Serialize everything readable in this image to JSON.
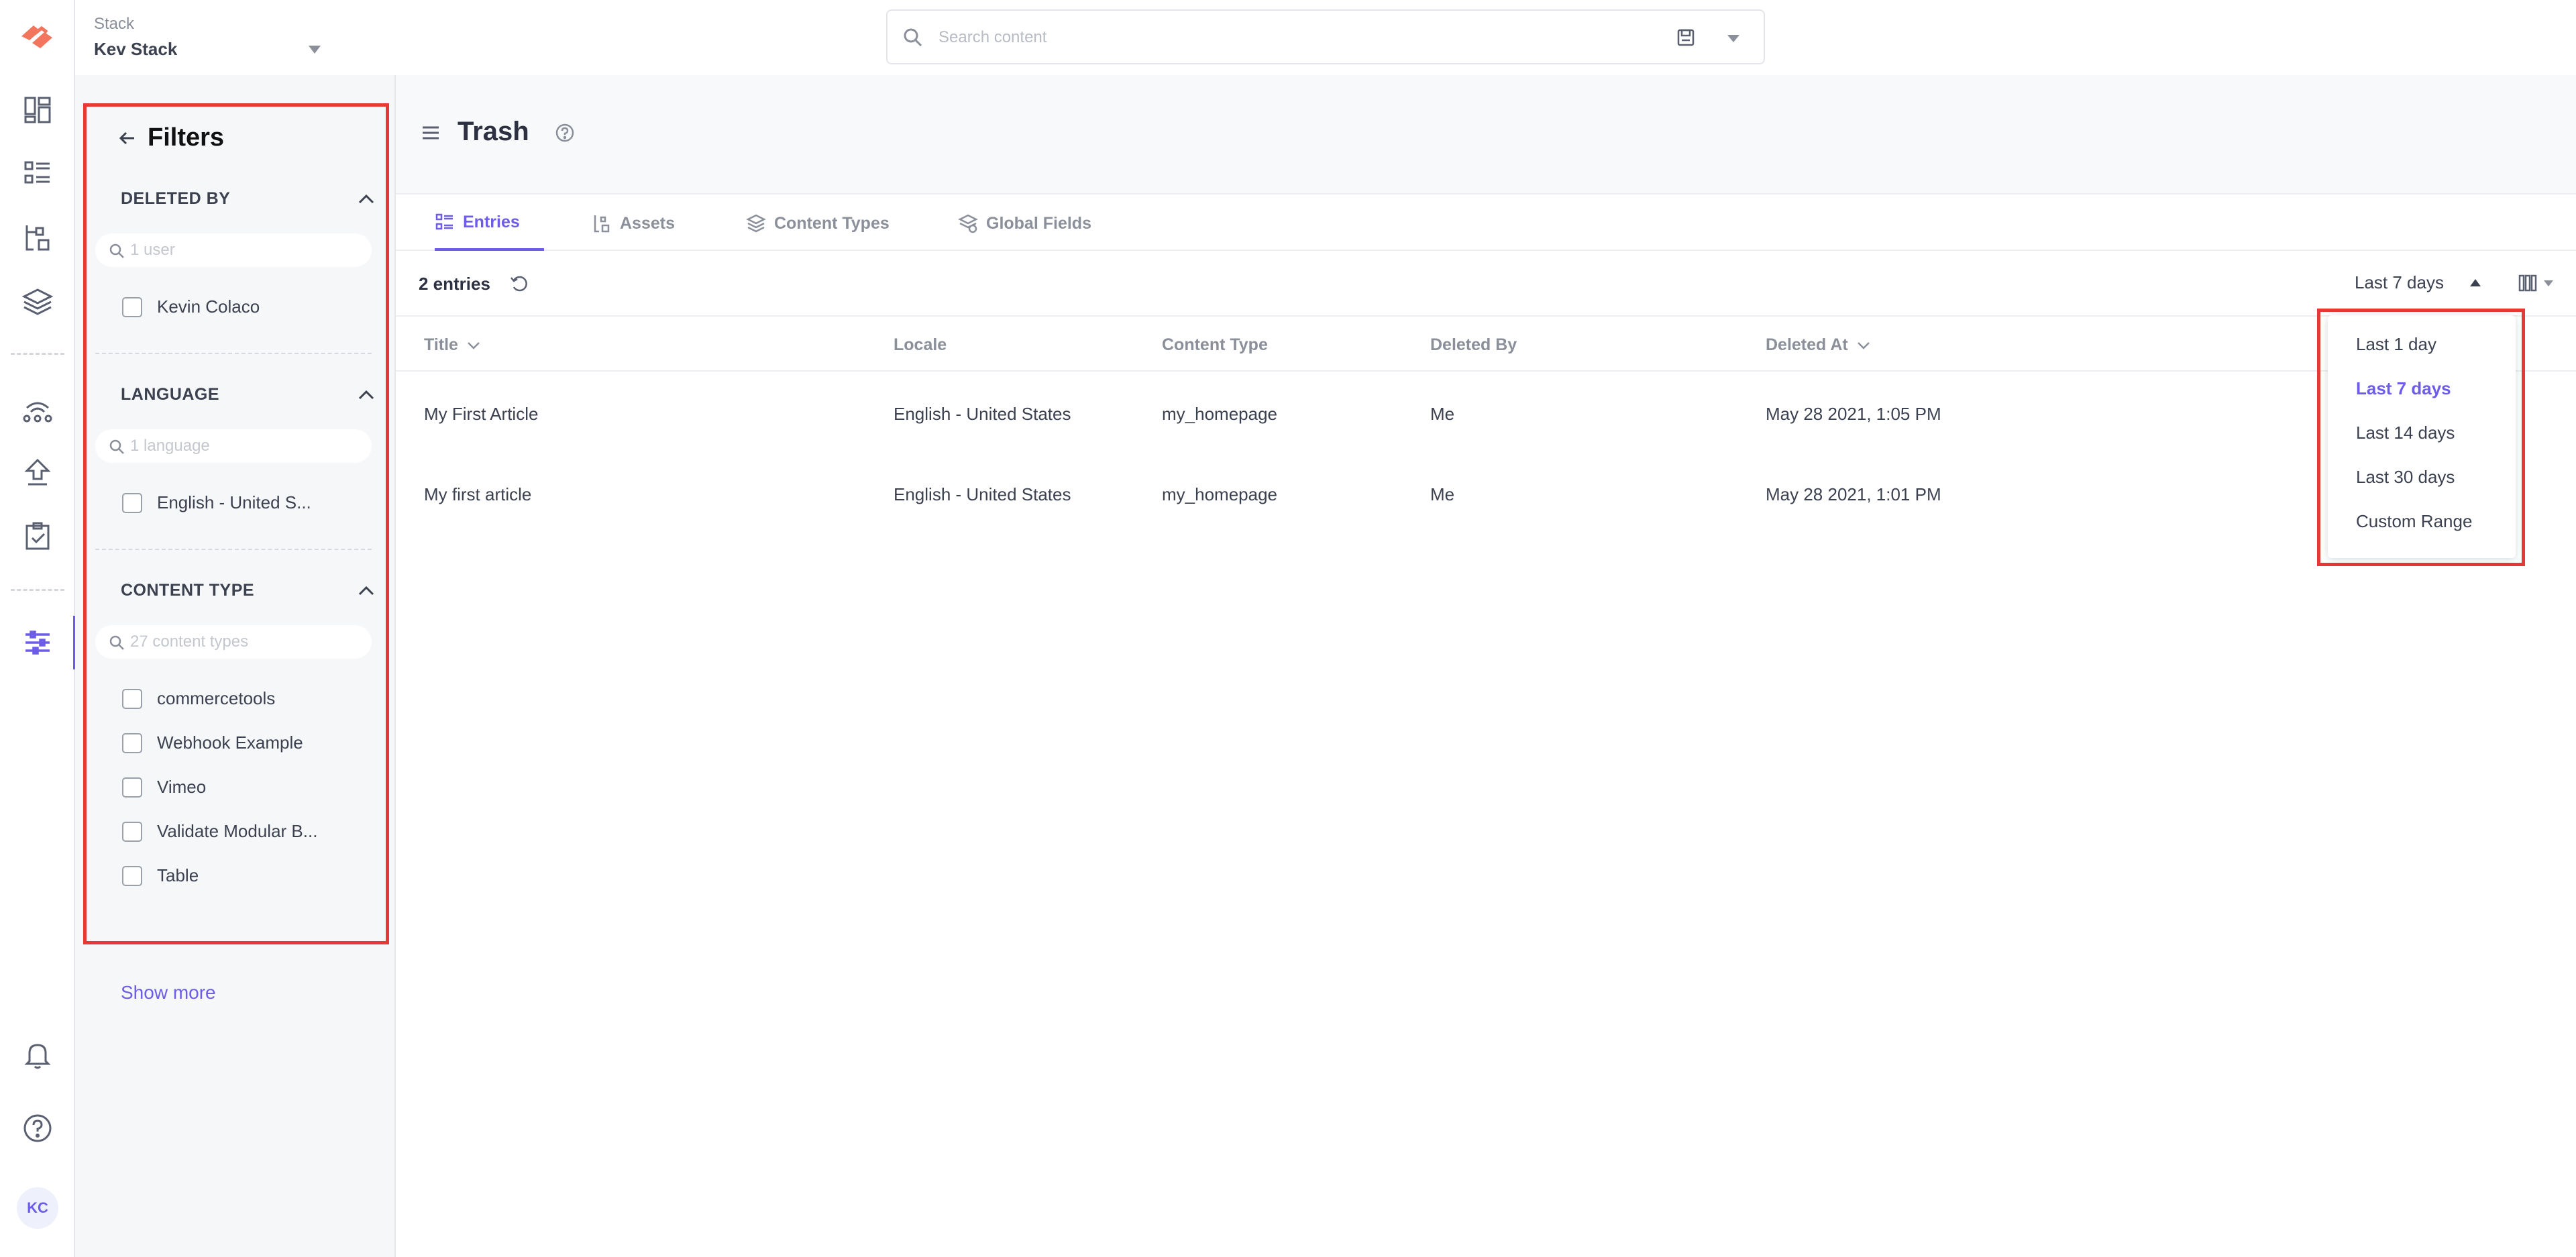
{
  "topbar": {
    "stack_label": "Stack",
    "stack_name": "Kev Stack",
    "search_placeholder": "Search content"
  },
  "rail": {
    "avatar_initials": "KC",
    "icons": [
      "logo-icon",
      "dashboard-icon",
      "entries-icon",
      "assets-icon",
      "content-types-icon",
      "deployments-icon",
      "publish-queue-icon",
      "tasks-icon",
      "settings-icon",
      "notifications-icon",
      "help-icon"
    ]
  },
  "filters": {
    "title": "Filters",
    "deleted_by": {
      "title": "DELETED BY",
      "placeholder": "1 user",
      "options": [
        "Kevin Colaco"
      ]
    },
    "language": {
      "title": "LANGUAGE",
      "placeholder": "1 language",
      "options": [
        "English - United S..."
      ]
    },
    "content_type": {
      "title": "CONTENT TYPE",
      "placeholder": "27 content types",
      "options": [
        "commercetools",
        "Webhook Example",
        "Vimeo",
        "Validate Modular B...",
        "Table"
      ]
    },
    "show_more": "Show more"
  },
  "page": {
    "title": "Trash",
    "tabs": [
      "Entries",
      "Assets",
      "Content Types",
      "Global Fields"
    ],
    "active_tab": "Entries",
    "entries_count": "2 entries",
    "range_label": "Last 7 days"
  },
  "table": {
    "headers": [
      "Title",
      "Locale",
      "Content Type",
      "Deleted By",
      "Deleted At"
    ],
    "rows": [
      [
        "My First Article",
        "English - United States",
        "my_homepage",
        "Me",
        "May 28 2021, 1:05 PM"
      ],
      [
        "My first article",
        "English - United States",
        "my_homepage",
        "Me",
        "May 28 2021, 1:01 PM"
      ]
    ]
  },
  "range_dropdown": {
    "options": [
      "Last 1 day",
      "Last 7 days",
      "Last 14 days",
      "Last 30 days",
      "Custom Range"
    ],
    "selected": "Last 7 days"
  },
  "colors": {
    "accent": "#6c5ce7",
    "highlight_frame": "#e53935",
    "text_dark": "#3c4150",
    "text_muted": "#8a8f99"
  }
}
